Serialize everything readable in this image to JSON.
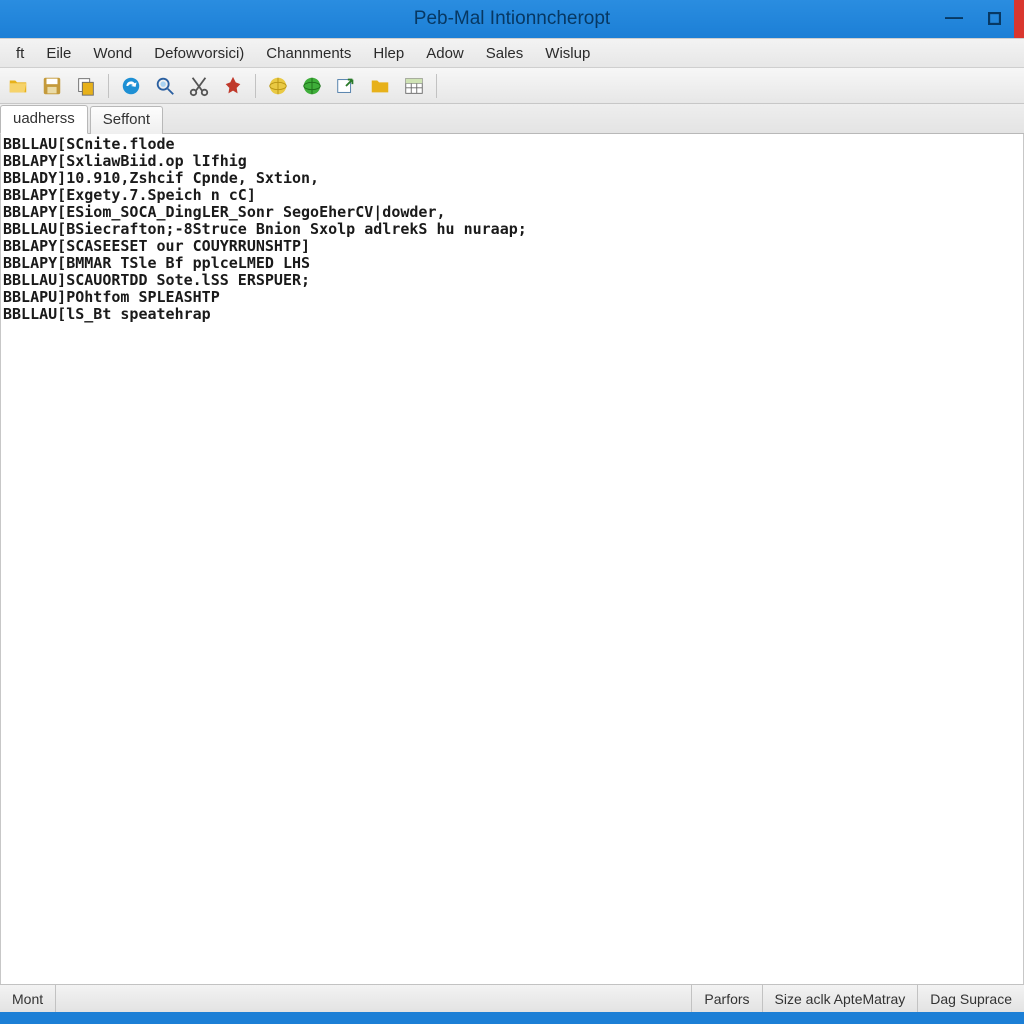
{
  "title": "Peb-Mal Intionncheropt",
  "menu": [
    {
      "label": "ft"
    },
    {
      "label": "Eile"
    },
    {
      "label": "Wond"
    },
    {
      "label": "Defowvorsici)"
    },
    {
      "label": "Channments"
    },
    {
      "label": "Hlep"
    },
    {
      "label": "Adow"
    },
    {
      "label": "Sales"
    },
    {
      "label": "Wislup"
    }
  ],
  "toolbar_icons": [
    "folder-open-icon",
    "save-icon",
    "copy-icon",
    "refresh-icon",
    "search-icon",
    "cut-icon",
    "pin-icon",
    "globe-yellow-icon",
    "globe-green-icon",
    "export-icon",
    "folder-icon",
    "table-icon"
  ],
  "tabs": [
    {
      "label": "uadherss",
      "active": true
    },
    {
      "label": "Seffont",
      "active": false
    }
  ],
  "lines": [
    "BBLLAU[SCnite.flode",
    "BBLAPY[SxliawBiid.op lIfhig",
    "BBLADY]10.910,Zshcif Cpnde, Sxtion,",
    "BBLAPY[Exgety.7.Speich n cC]",
    "BBLAPY[ESiom_SOCA_DingLER_Sonr SegoEherCV|dowder,",
    "BBLLAU[BSiecrafton;-8Struce Bnion Sxolp adlrekS hu nuraap;",
    "BBLAPY[SCASEESET our COUYRRUNSHTP]",
    "BBLAPY[BMMAR TSle Bf pplceLMED LHS",
    "BBLLAU]SCAUORTDD Sote.lSS ERSPUER;",
    "BBLAPU]POhtfom SPLEASHTP",
    "BBLLAU[lS_Bt speatehrap"
  ],
  "status": {
    "left": "Mont",
    "panels": [
      "Parfors",
      "Size aclk ApteMatray",
      "Dag Suprace"
    ]
  }
}
